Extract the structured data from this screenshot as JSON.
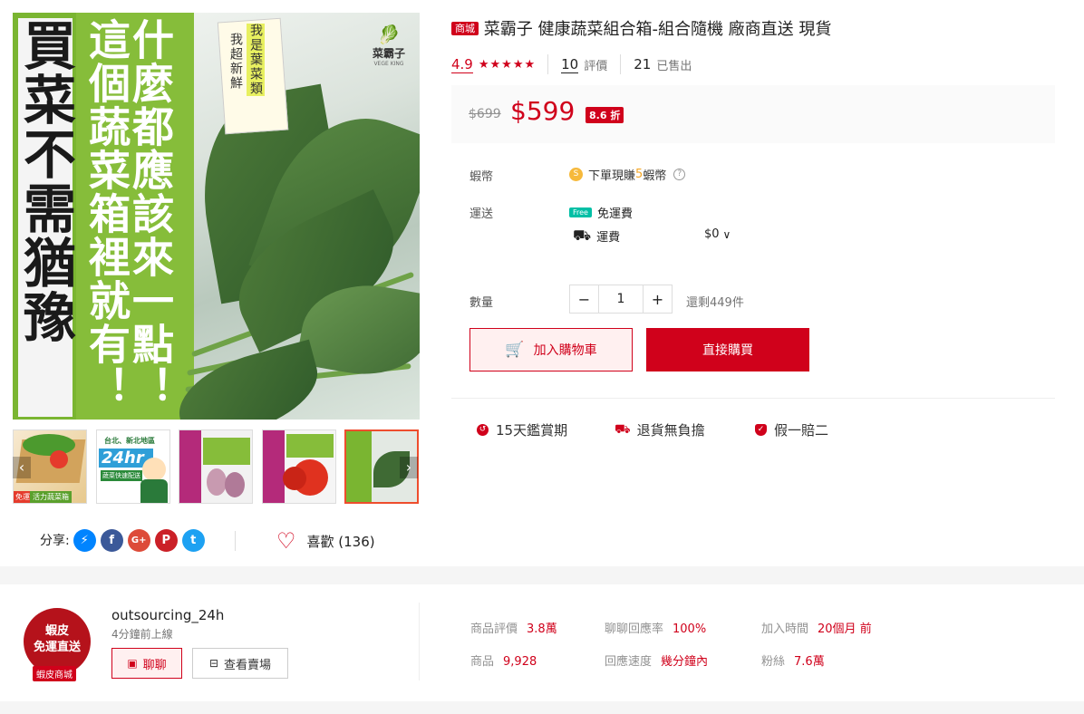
{
  "product": {
    "mall_badge": "商城",
    "title": "菜霸子 健康蔬菜組合箱-組合隨機 廠商直送 現貨",
    "rating": "4.9",
    "reviews_count": "10",
    "reviews_label": "評價",
    "sold_count": "21",
    "sold_label": "已售出",
    "old_price": "$699",
    "price": "$599",
    "discount": "8.6 折"
  },
  "image_text": {
    "col1": "買菜不需猶豫",
    "col2": "這個蔬菜箱裡就有！",
    "col3": "什麼都應該來一點！",
    "tag1": "我超新鮮",
    "tag2": "我是葉菜類",
    "logo": "菜霸子",
    "logo_sub": "VEGE KING"
  },
  "details": {
    "coins_label": "蝦幣",
    "coins_prefix": "下單現賺",
    "coins_num": "5",
    "coins_suffix": "蝦幣",
    "shipping_label": "運送",
    "free_tag": "Free",
    "free_ship": "免運費",
    "ship_fee_label": "運費",
    "ship_fee": "$0",
    "qty_label": "數量",
    "qty_value": "1",
    "stock": "還剩449件",
    "add_cart": "加入購物車",
    "buy_now": "直接購買"
  },
  "guarantees": [
    "15天鑑賞期",
    "退貨無負擔",
    "假一賠二"
  ],
  "share": {
    "label": "分享:",
    "like_label": "喜歡 (136)"
  },
  "thumbnails": [
    {
      "name": "thumb-vegetable-box",
      "caption": "活力蔬菜箱"
    },
    {
      "name": "thumb-24hr-delivery",
      "caption": "24hr"
    },
    {
      "name": "thumb-shallots",
      "caption": ""
    },
    {
      "name": "thumb-tomato",
      "caption": ""
    },
    {
      "name": "thumb-greens",
      "caption": ""
    }
  ],
  "thumb_texts": {
    "t1_badge": "免運",
    "t2_title": "台北、新北地區",
    "t2_big": "24hr",
    "t2_sub": "蔬菜快速配送"
  },
  "shop": {
    "avatar_line1": "蝦皮",
    "avatar_line2": "免運直送",
    "avatar_badge": "蝦皮商城",
    "name": "outsourcing_24h",
    "online": "4分鐘前上線",
    "chat": "聊聊",
    "view_shop": "查看賣場",
    "stats": [
      {
        "k": "商品評價",
        "v": "3.8萬"
      },
      {
        "k": "聊聊回應率",
        "v": "100%"
      },
      {
        "k": "加入時間",
        "v": "20個月 前"
      },
      {
        "k": "商品",
        "v": "9,928"
      },
      {
        "k": "回應速度",
        "v": "幾分鐘內"
      },
      {
        "k": "粉絲",
        "v": "7.6萬"
      }
    ]
  },
  "colors": {
    "accent": "#d0011b",
    "brand_green": "#7ab531"
  }
}
